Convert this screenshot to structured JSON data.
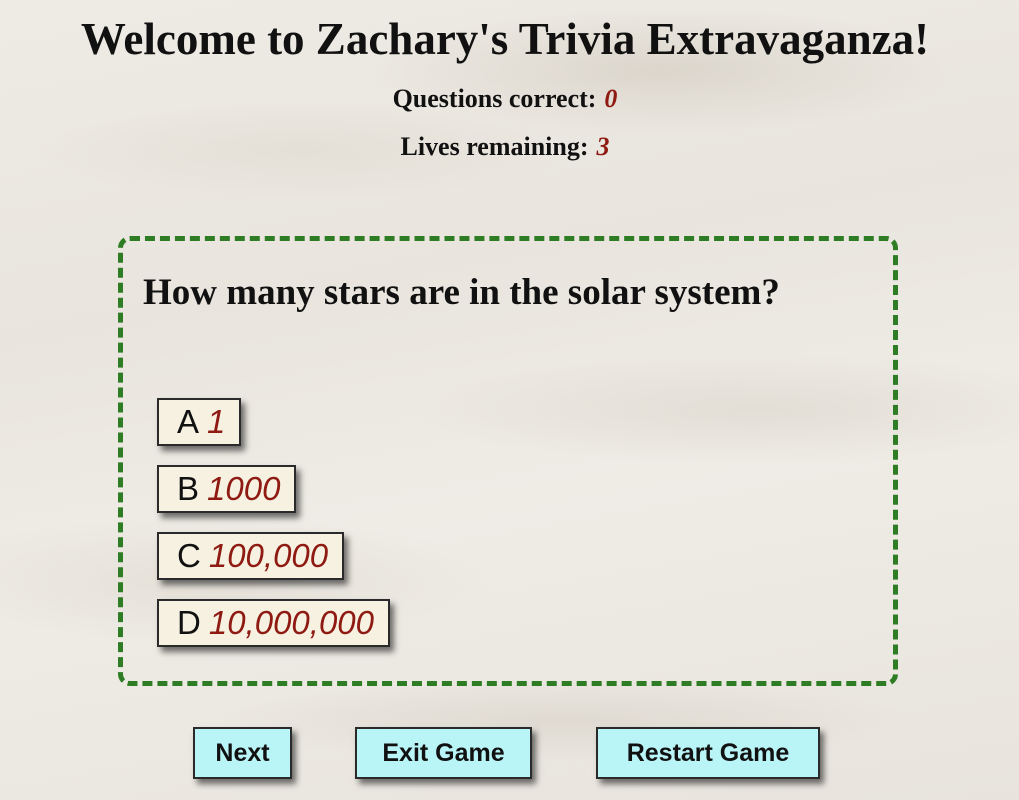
{
  "header": {
    "title": "Welcome to Zachary's Trivia Extravaganza!"
  },
  "stats": {
    "correct_label": "Questions correct:",
    "correct_value": "0",
    "lives_label": "Lives remaining:",
    "lives_value": "3"
  },
  "quiz": {
    "question": "How many stars are in the solar system?",
    "answers": [
      {
        "letter": "A",
        "text": "1"
      },
      {
        "letter": "B",
        "text": "1000"
      },
      {
        "letter": "C",
        "text": "100,000"
      },
      {
        "letter": "D",
        "text": "10,000,000"
      }
    ]
  },
  "controls": {
    "next_label": "Next",
    "exit_label": "Exit Game",
    "restart_label": "Restart Game"
  },
  "colors": {
    "accent_border": "#2e7d24",
    "answer_text": "#8e1a12",
    "answer_bg": "#f6f1e1",
    "button_bg": "#b9f4f6"
  }
}
